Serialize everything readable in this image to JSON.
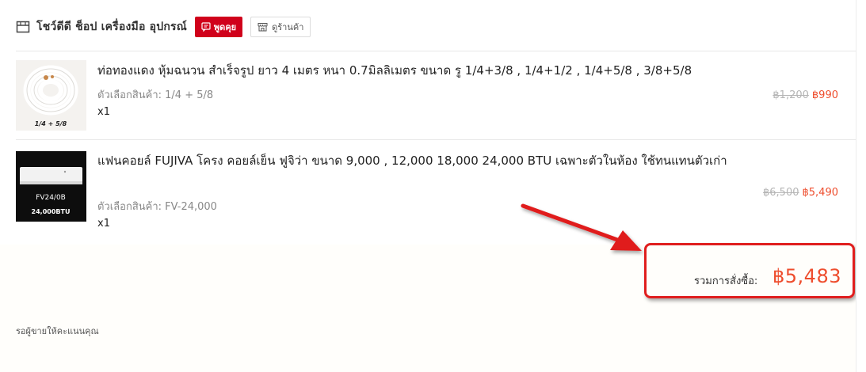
{
  "shop": {
    "name": "โชว์ดีดี ช็อป เครื่องมือ อุปกรณ์",
    "chat_label": "พูดคุย",
    "view_shop_label": "ดูร้านค้า"
  },
  "items": [
    {
      "title": "ท่อทองแดง หุ้มฉนวน สำเร็จรูป ยาว 4 เมตร หนา 0.7มิลลิเมตร ขนาด รู 1/4+3/8 , 1/4+1/2 , 1/4+5/8 , 3/8+5/8",
      "variant": "ตัวเลือกสินค้า: 1/4 + 5/8",
      "quantity": "x1",
      "original_price": "฿1,200",
      "price": "฿990",
      "image_caption": "1/4 + 5/8"
    },
    {
      "title": "แฟนคอยล์ FUJIVA โครง คอยล์เย็น ฟูจิว่า ขนาด 9,000 , 12,000 18,000 24,000 BTU เฉพาะตัวในห้อง ใช้ทนแทนตัวเก่า",
      "variant": "ตัวเลือกสินค้า: FV-24,000",
      "quantity": "x1",
      "original_price": "฿6,500",
      "price": "฿5,490",
      "image_caption_1": "FV24/0B",
      "image_caption_2": "24,000BTU"
    }
  ],
  "order_total": {
    "label": "รวมการสั่งซื้อ:",
    "value": "฿5,483"
  },
  "footer": {
    "status_text": "รอผู้ขายให้คะแนนคุณ"
  },
  "colors": {
    "accent": "#ee4d2d",
    "chat_button": "#d0011b",
    "annotation": "#e01e1e"
  },
  "icons": {
    "shop": "store-icon",
    "chat": "chat-icon",
    "view_shop": "shop-front-icon"
  }
}
